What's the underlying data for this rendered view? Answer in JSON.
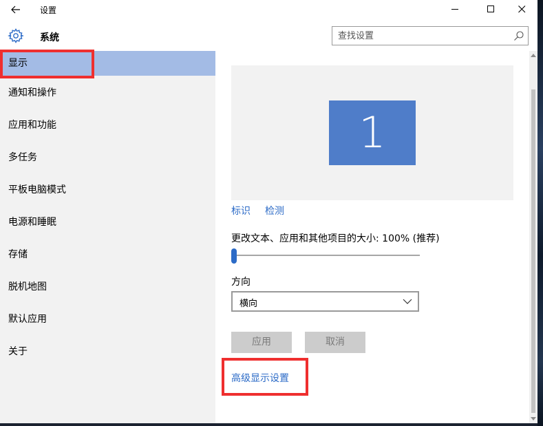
{
  "window": {
    "title": "设置"
  },
  "header": {
    "title": "系统",
    "search_placeholder": "查找设置"
  },
  "sidebar": {
    "items": [
      {
        "label": "显示",
        "selected": true
      },
      {
        "label": "通知和操作"
      },
      {
        "label": "应用和功能"
      },
      {
        "label": "多任务"
      },
      {
        "label": "平板电脑模式"
      },
      {
        "label": "电源和睡眠"
      },
      {
        "label": "存储"
      },
      {
        "label": "脱机地图"
      },
      {
        "label": "默认应用"
      },
      {
        "label": "关于"
      }
    ]
  },
  "main": {
    "monitor_number": "1",
    "identify_link": "标识",
    "detect_link": "检测",
    "scale_label": "更改文本、应用和其他项目的大小: 100% (推荐)",
    "scale_slider_fraction": 0,
    "orientation_label": "方向",
    "orientation_value": "横向",
    "apply_label": "应用",
    "cancel_label": "取消",
    "advanced_link": "高级显示设置"
  },
  "icons": {
    "back": "back-arrow-icon",
    "gear": "gear-icon",
    "search": "search-icon",
    "minimize": "minimize-icon",
    "maximize": "maximize-icon",
    "close": "close-icon",
    "dropdown": "chevron-down-icon"
  },
  "colors": {
    "accent": "#2c6bc7",
    "sidebar_selected": "#a3bbe5",
    "monitor_tile": "#4f7dc9",
    "highlight": "#ef2f2f"
  }
}
